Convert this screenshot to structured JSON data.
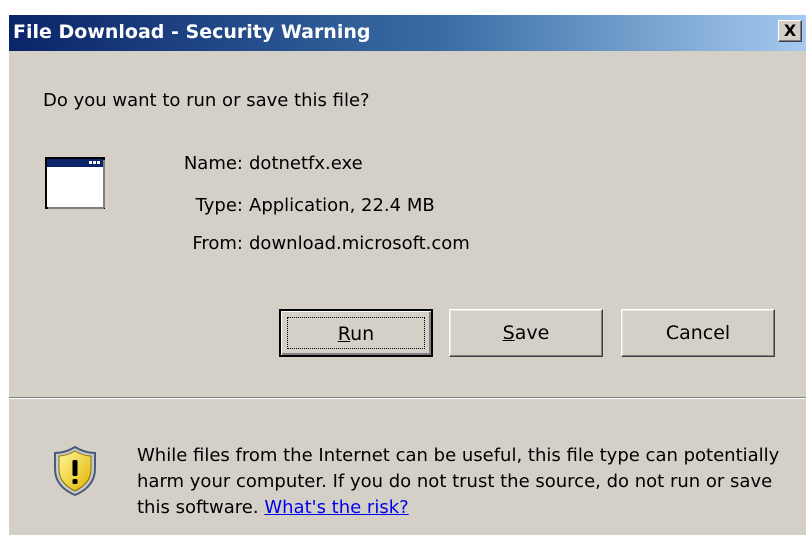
{
  "window": {
    "title": "File Download - Security Warning",
    "close_label": "X"
  },
  "dialog": {
    "question": "Do you want to run or save this file?",
    "file": {
      "name_label": "Name:",
      "name_value": "dotnetfx.exe",
      "type_label": "Type:",
      "type_value": "Application, 22.4 MB",
      "from_label": "From:",
      "from_value": "download.microsoft.com"
    },
    "buttons": {
      "run_mnemonic": "R",
      "run_rest": "un",
      "save_mnemonic": "S",
      "save_rest": "ave",
      "cancel": "Cancel"
    },
    "warning": {
      "text": "While files from the Internet can be useful, this file type can potentially harm your computer. If you do not trust the source, do not run or save this software.",
      "link": "What's the risk?"
    }
  },
  "icons": {
    "app": "application-window-icon",
    "shield": "security-shield-icon"
  },
  "colors": {
    "titlebar_start": "#0a246a",
    "titlebar_end": "#a6caf0",
    "dialog_bg": "#d4d0c8",
    "link": "#0000ee",
    "shield_yellow": "#f2d21b"
  }
}
